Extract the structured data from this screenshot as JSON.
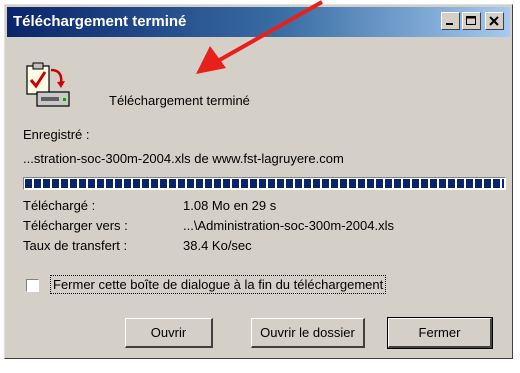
{
  "window": {
    "title": "Téléchargement terminé"
  },
  "header": {
    "text": "Téléchargement terminé"
  },
  "saved": {
    "label": "Enregistré :",
    "source": "...stration-soc-300m-2004.xls de www.fst-lagruyere.com"
  },
  "progress": {
    "fraction": 1.0
  },
  "details": {
    "downloaded_label": "Téléchargé :",
    "downloaded_value": "1.08 Mo en 29 s",
    "dest_label": "Télécharger vers :",
    "dest_value": "...\\Administration-soc-300m-2004.xls",
    "rate_label": "Taux de transfert :",
    "rate_value": "38.4 Ko/sec"
  },
  "close_on_finish": {
    "checked": false,
    "label": "Fermer cette boîte de dialogue à la fin du téléchargement"
  },
  "buttons": {
    "open": "Ouvrir",
    "open_folder": "Ouvrir le dossier",
    "close": "Fermer"
  },
  "colors": {
    "titlebar_start": "#0a246a",
    "titlebar_end": "#a6caf0",
    "dialog_bg": "#d4d0c8",
    "progress_block": "#0a246a",
    "annotation_arrow": "#e8201a"
  },
  "icons": {
    "title_buttons": [
      "minimize-icon",
      "maximize-icon",
      "close-icon"
    ],
    "header": "download-complete-icon",
    "annotation": "red-arrow-icon"
  }
}
